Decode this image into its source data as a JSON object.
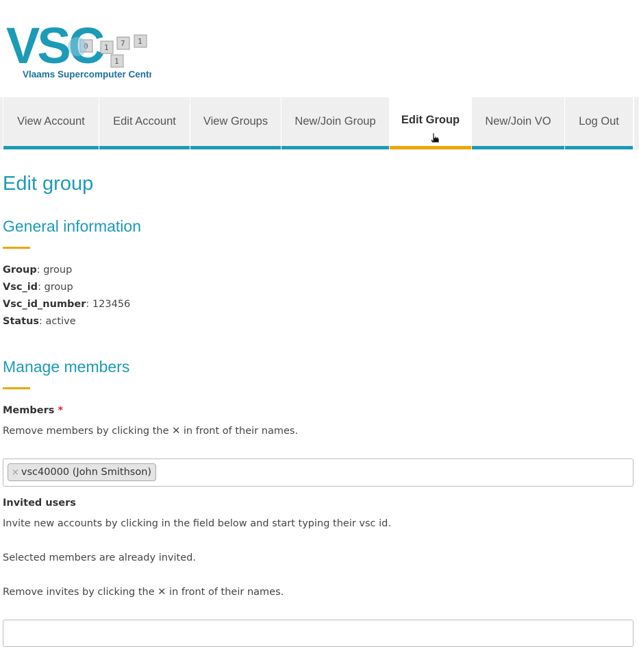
{
  "logo": {
    "letters": "VSC",
    "tagline": "Vlaams Supercomputer Centrum"
  },
  "nav": {
    "tabs": [
      {
        "label": "View Account"
      },
      {
        "label": "Edit Account"
      },
      {
        "label": "View Groups"
      },
      {
        "label": "New/Join Group"
      },
      {
        "label": "Edit Group",
        "active": true
      },
      {
        "label": "New/Join VO"
      },
      {
        "label": "Log Out"
      }
    ]
  },
  "page": {
    "title": "Edit group"
  },
  "general": {
    "heading": "General information",
    "fields": [
      {
        "label": "Group",
        "value": ": group"
      },
      {
        "label": "Vsc_id",
        "value": ": group"
      },
      {
        "label": "Vsc_id_number",
        "value": ": 123456"
      },
      {
        "label": "Status",
        "value": ": active"
      }
    ]
  },
  "manage": {
    "heading": "Manage members",
    "members_label": "Members",
    "required_mark": "*",
    "members_help": "Remove members by clicking the ✕ in front of their names.",
    "members": [
      {
        "remove": "×",
        "name": "vsc40000 (John Smithson)"
      }
    ],
    "invited_label": "Invited users",
    "invite_help_1": "Invite new accounts by clicking in the field below and start typing their vsc id.",
    "invite_help_2": "Selected members are already invited.",
    "invite_help_3": "Remove invites by clicking the ✕ in front of their names."
  },
  "colors": {
    "accent": "#1b9bb7",
    "highlight": "#f0a500",
    "tab_bg": "#efefef",
    "required": "#d9232e"
  },
  "icons": {
    "cursor": "hand-pointer-icon"
  }
}
